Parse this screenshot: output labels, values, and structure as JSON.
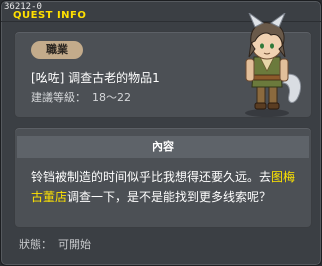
{
  "window": {
    "id_label": "36212-0",
    "title": "QUEST INFO"
  },
  "quest": {
    "category_tag": "職業",
    "name": "[吆咗] 调查古老的物品1",
    "level_label": "建議等級：",
    "level_range": "18～22"
  },
  "content": {
    "header": "內容",
    "text_part1": "铃铛被制造的时间似乎比我想得还要久远。去",
    "highlight1": "图梅",
    "highlight2": "古董店",
    "text_part2": "调查一下，是不是能找到更多线索呢？"
  },
  "status": {
    "label": "狀態：",
    "value": "可開始"
  },
  "colors": {
    "title_accent": "#ffe000",
    "highlight": "#ffe400",
    "tag_background": "#c3ab8b",
    "panel_background": "#4c5055",
    "window_background": "#3b3f44"
  },
  "icons": {
    "character_portrait": "wolf-eared-character-avatar"
  }
}
